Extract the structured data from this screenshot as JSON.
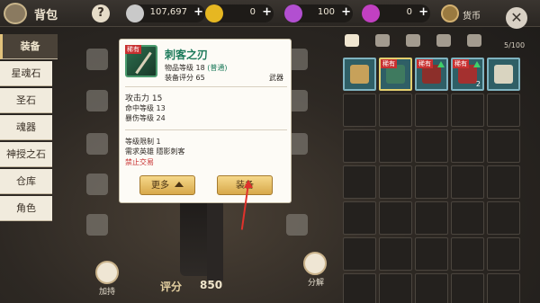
{
  "window": {
    "title": "背包"
  },
  "currencies": [
    {
      "name": "silver",
      "value": "107,697",
      "plus": "+",
      "color": "#c9c9c9"
    },
    {
      "name": "gold",
      "value": "0",
      "plus": "+",
      "color": "#e6b722"
    },
    {
      "name": "crystal",
      "value": "100",
      "plus": "+",
      "color": "#b24fd1"
    },
    {
      "name": "gem",
      "value": "0",
      "plus": "+",
      "color": "#c240c2"
    }
  ],
  "coin_button": {
    "label": "货币"
  },
  "close_symbol": "✕",
  "help_symbol": "?",
  "left_nav": [
    "装备",
    "星魂石",
    "圣石",
    "魂器",
    "神授之石",
    "仓库",
    "角色"
  ],
  "active_nav": 0,
  "tooltip": {
    "badge": "稀有",
    "name": "刺客之刃",
    "level_label": "物品等级 18",
    "grade": "(普通)",
    "score_label": "装备评分 65",
    "type": "武器",
    "attack": "攻击力 15",
    "hit": "命中等级 13",
    "crit": "暴伤等级 24",
    "req_level": "等级限制 1",
    "req_hero": "需求英雄 隱影刺客",
    "no_trade": "禁止交易",
    "more_button": "更多",
    "equip_button": "装备"
  },
  "bottom": {
    "upgrade_label": "加持",
    "score_label": "评分",
    "score_value": "850",
    "decompose_label": "分解"
  },
  "inventory": {
    "count": "5/100",
    "items": [
      {
        "name": "scroll",
        "color": "#c7a15a"
      },
      {
        "name": "dagger",
        "color": "#3f7a5f",
        "badge": "稀有",
        "selected": true
      },
      {
        "name": "red-blade",
        "color": "#8c2f2a",
        "badge": "稀有",
        "upgrade": true
      },
      {
        "name": "red-dagger",
        "color": "#a4302f",
        "badge": "稀有",
        "upgrade": true,
        "qty": "2"
      },
      {
        "name": "bracelet",
        "color": "#d9d4c0"
      }
    ]
  }
}
